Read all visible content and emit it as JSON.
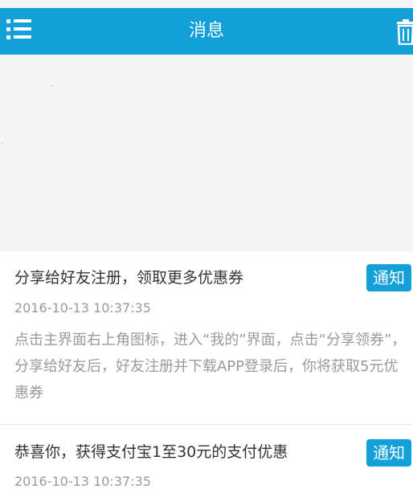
{
  "header": {
    "title": "消息",
    "left_icon": "menu-list-icon",
    "right_icon": "trash-icon",
    "bar_color": "#139fd8"
  },
  "messages": [
    {
      "title": "分享给好友注册，领取更多优惠券",
      "badge": "通知",
      "time": "2016-10-13 10:37:35",
      "body": "点击主界面右上角图标，进入“我的”界面，点击“分享领券”，分享给好友后，好友注册并下载APP登录后，你将获取5元优惠券"
    },
    {
      "title": "恭喜你，获得支付宝1至30元的支付优惠",
      "badge": "通知",
      "time": "2016-10-13 10:37:35"
    }
  ]
}
